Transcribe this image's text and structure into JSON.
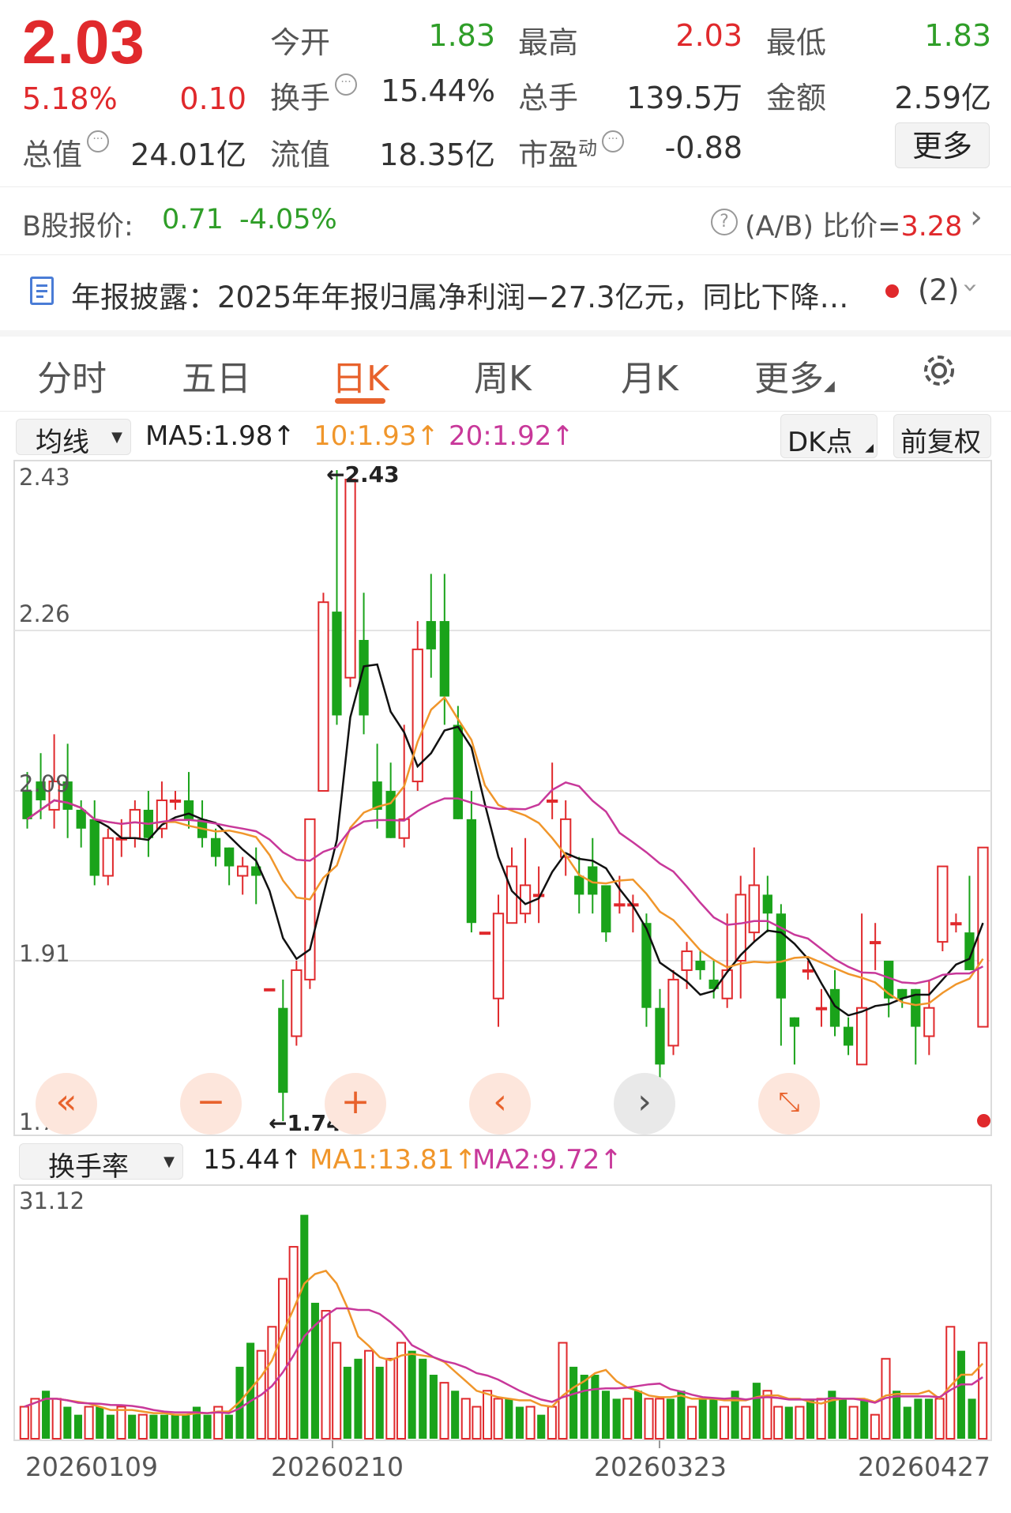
{
  "quote": {
    "price": "2.03",
    "change_pct": "5.18%",
    "change": "0.10",
    "open_label": "今开",
    "open": "1.83",
    "high_label": "最高",
    "high": "2.03",
    "low_label": "最低",
    "low": "1.83",
    "turnover_label": "换手",
    "turnover": "15.44%",
    "volume_label": "总手",
    "volume": "139.5万",
    "amount_label": "金额",
    "amount": "2.59亿",
    "mktcap_label": "总值",
    "mktcap": "24.01亿",
    "float_label": "流值",
    "float_cap": "18.35亿",
    "pe_label": "市盈",
    "pe_sup": "动",
    "pe": "-0.88",
    "more_button": "更多"
  },
  "b_share": {
    "label": "B股报价:",
    "price": "0.71",
    "change": "-4.05%",
    "ratio_label": "(A/B) 比价=",
    "ratio": "3.28"
  },
  "news": {
    "text": "年报披露：2025年年报归属净利润−27.3亿元，同比下降…",
    "count": "(2)"
  },
  "tabs": [
    "分时",
    "五日",
    "日K",
    "周K",
    "月K",
    "更多"
  ],
  "active_tab": "日K",
  "indicator_bar": {
    "select": "均线",
    "ma5": "MA5:1.98",
    "ma10": "10:1.93",
    "ma20": "20:1.92",
    "dk_button": "DK点",
    "adjust_button": "前复权"
  },
  "volume_bar": {
    "select": "换手率",
    "value": "15.44",
    "ma1": "MA1:13.81",
    "ma2": "MA2:9.72"
  },
  "colors": {
    "up": "#e0292c",
    "down": "#1aa31a",
    "ma5": "#111111",
    "ma10": "#f0962b",
    "ma20": "#c8389a",
    "accent": "#e8622c"
  },
  "chart_data": {
    "type": "candlestick",
    "y_ticks": [
      "2.43",
      "2.26",
      "2.09",
      "1.91",
      "1.74"
    ],
    "ylim": [
      1.74,
      2.43
    ],
    "annotations": {
      "max_label": "←2.43",
      "min_label": "←1.74"
    },
    "x_tick_labels": [
      "20260109",
      "20260210",
      "20260323",
      "20260427"
    ],
    "candles": [
      {
        "o": 2.09,
        "c": 2.06,
        "h": 2.11,
        "l": 2.05
      },
      {
        "o": 2.1,
        "c": 2.08,
        "h": 2.13,
        "l": 2.06
      },
      {
        "o": 2.07,
        "c": 2.1,
        "h": 2.15,
        "l": 2.05
      },
      {
        "o": 2.1,
        "c": 2.07,
        "h": 2.14,
        "l": 2.04
      },
      {
        "o": 2.07,
        "c": 2.05,
        "h": 2.08,
        "l": 2.03
      },
      {
        "o": 2.06,
        "c": 2.0,
        "h": 2.08,
        "l": 1.99
      },
      {
        "o": 2.0,
        "c": 2.04,
        "h": 2.05,
        "l": 1.99
      },
      {
        "o": 2.04,
        "c": 2.04,
        "h": 2.06,
        "l": 2.02
      },
      {
        "o": 2.04,
        "c": 2.07,
        "h": 2.08,
        "l": 2.03
      },
      {
        "o": 2.07,
        "c": 2.04,
        "h": 2.09,
        "l": 2.02
      },
      {
        "o": 2.05,
        "c": 2.08,
        "h": 2.1,
        "l": 2.04
      },
      {
        "o": 2.08,
        "c": 2.08,
        "h": 2.09,
        "l": 2.07
      },
      {
        "o": 2.08,
        "c": 2.06,
        "h": 2.11,
        "l": 2.05
      },
      {
        "o": 2.06,
        "c": 2.04,
        "h": 2.08,
        "l": 2.03
      },
      {
        "o": 2.04,
        "c": 2.02,
        "h": 2.05,
        "l": 2.01
      },
      {
        "o": 2.03,
        "c": 2.01,
        "h": 2.03,
        "l": 1.99
      },
      {
        "o": 2.0,
        "c": 2.01,
        "h": 2.02,
        "l": 1.98
      },
      {
        "o": 2.01,
        "c": 2.0,
        "h": 2.03,
        "l": 1.97
      },
      {
        "o": 1.88,
        "c": 1.88,
        "h": 1.88,
        "l": 1.88
      },
      {
        "o": 1.86,
        "c": 1.77,
        "h": 1.89,
        "l": 1.74
      },
      {
        "o": 1.83,
        "c": 1.9,
        "h": 1.91,
        "l": 1.82
      },
      {
        "o": 1.89,
        "c": 2.06,
        "h": 2.06,
        "l": 1.88
      },
      {
        "o": 2.09,
        "c": 2.29,
        "h": 2.3,
        "l": 2.09
      },
      {
        "o": 2.28,
        "c": 2.17,
        "h": 2.43,
        "l": 2.16
      },
      {
        "o": 2.21,
        "c": 2.42,
        "h": 2.42,
        "l": 2.2
      },
      {
        "o": 2.25,
        "c": 2.17,
        "h": 2.3,
        "l": 2.15
      },
      {
        "o": 2.1,
        "c": 2.07,
        "h": 2.14,
        "l": 2.05
      },
      {
        "o": 2.09,
        "c": 2.04,
        "h": 2.12,
        "l": 2.04
      },
      {
        "o": 2.04,
        "c": 2.06,
        "h": 2.16,
        "l": 2.03
      },
      {
        "o": 2.1,
        "c": 2.24,
        "h": 2.27,
        "l": 2.09
      },
      {
        "o": 2.27,
        "c": 2.24,
        "h": 2.32,
        "l": 2.21
      },
      {
        "o": 2.27,
        "c": 2.19,
        "h": 2.32,
        "l": 2.16
      },
      {
        "o": 2.16,
        "c": 2.06,
        "h": 2.18,
        "l": 2.06
      },
      {
        "o": 2.06,
        "c": 1.95,
        "h": 2.09,
        "l": 1.94
      },
      {
        "o": 1.94,
        "c": 1.94,
        "h": 1.94,
        "l": 1.94
      },
      {
        "o": 1.87,
        "c": 1.96,
        "h": 1.98,
        "l": 1.84
      },
      {
        "o": 1.95,
        "c": 2.01,
        "h": 2.03,
        "l": 1.95
      },
      {
        "o": 1.96,
        "c": 1.99,
        "h": 2.04,
        "l": 1.95
      },
      {
        "o": 1.98,
        "c": 1.98,
        "h": 2.01,
        "l": 1.95
      },
      {
        "o": 2.08,
        "c": 2.08,
        "h": 2.12,
        "l": 2.06
      },
      {
        "o": 2.02,
        "c": 2.06,
        "h": 2.08,
        "l": 2.0
      },
      {
        "o": 2.0,
        "c": 1.98,
        "h": 2.02,
        "l": 1.96
      },
      {
        "o": 2.01,
        "c": 1.98,
        "h": 2.04,
        "l": 1.96
      },
      {
        "o": 1.99,
        "c": 1.94,
        "h": 1.99,
        "l": 1.93
      },
      {
        "o": 1.97,
        "c": 1.97,
        "h": 2.0,
        "l": 1.96
      },
      {
        "o": 1.97,
        "c": 1.97,
        "h": 1.98,
        "l": 1.94
      },
      {
        "o": 1.95,
        "c": 1.86,
        "h": 1.96,
        "l": 1.84
      },
      {
        "o": 1.86,
        "c": 1.8,
        "h": 1.88,
        "l": 1.78
      },
      {
        "o": 1.82,
        "c": 1.89,
        "h": 1.9,
        "l": 1.81
      },
      {
        "o": 1.9,
        "c": 1.92,
        "h": 1.93,
        "l": 1.88
      },
      {
        "o": 1.91,
        "c": 1.9,
        "h": 1.92,
        "l": 1.89
      },
      {
        "o": 1.89,
        "c": 1.88,
        "h": 1.91,
        "l": 1.87
      },
      {
        "o": 1.87,
        "c": 1.9,
        "h": 1.96,
        "l": 1.86
      },
      {
        "o": 1.91,
        "c": 1.98,
        "h": 2.0,
        "l": 1.87
      },
      {
        "o": 1.94,
        "c": 1.99,
        "h": 2.03,
        "l": 1.93
      },
      {
        "o": 1.98,
        "c": 1.96,
        "h": 2.0,
        "l": 1.94
      },
      {
        "o": 1.96,
        "c": 1.87,
        "h": 1.97,
        "l": 1.82
      },
      {
        "o": 1.85,
        "c": 1.84,
        "h": 1.85,
        "l": 1.8
      },
      {
        "o": 1.9,
        "c": 1.9,
        "h": 1.91,
        "l": 1.89
      },
      {
        "o": 1.86,
        "c": 1.86,
        "h": 1.88,
        "l": 1.84
      },
      {
        "o": 1.88,
        "c": 1.84,
        "h": 1.9,
        "l": 1.83
      },
      {
        "o": 1.84,
        "c": 1.82,
        "h": 1.85,
        "l": 1.81
      },
      {
        "o": 1.8,
        "c": 1.86,
        "h": 1.96,
        "l": 1.8
      },
      {
        "o": 1.93,
        "c": 1.93,
        "h": 1.95,
        "l": 1.9
      },
      {
        "o": 1.91,
        "c": 1.87,
        "h": 1.91,
        "l": 1.85
      },
      {
        "o": 1.88,
        "c": 1.87,
        "h": 1.88,
        "l": 1.86
      },
      {
        "o": 1.88,
        "c": 1.84,
        "h": 1.88,
        "l": 1.8
      },
      {
        "o": 1.83,
        "c": 1.86,
        "h": 1.89,
        "l": 1.81
      },
      {
        "o": 1.93,
        "c": 2.01,
        "h": 2.01,
        "l": 1.92
      },
      {
        "o": 1.95,
        "c": 1.95,
        "h": 1.96,
        "l": 1.94
      },
      {
        "o": 1.94,
        "c": 1.9,
        "h": 2.0,
        "l": 1.9
      },
      {
        "o": 1.84,
        "c": 2.03,
        "h": 2.03,
        "l": 1.84
      }
    ]
  },
  "volume_data": {
    "y_tick": "31.12",
    "values": [
      4,
      5,
      6,
      5,
      4,
      3,
      4,
      4,
      3,
      4,
      3,
      3,
      3,
      3,
      3,
      3,
      4,
      3,
      4,
      3,
      9,
      12,
      11,
      14,
      20,
      24,
      28,
      17,
      16,
      12,
      9,
      10,
      11,
      9,
      10,
      12,
      11,
      10,
      8,
      7,
      6,
      5,
      4,
      6,
      5,
      5,
      4,
      4,
      3,
      4,
      12,
      9,
      8,
      8,
      6,
      5,
      5,
      6,
      5,
      5,
      5,
      6,
      4,
      5,
      5,
      4,
      6,
      4,
      7,
      6,
      4,
      4,
      4,
      5,
      5,
      6,
      5,
      4,
      5,
      3,
      10,
      6,
      4,
      5,
      5,
      5,
      14,
      11,
      5,
      12
    ],
    "up": [
      1,
      1,
      0,
      1,
      0,
      0,
      1,
      0,
      0,
      1,
      0,
      1,
      0,
      0,
      0,
      0,
      0,
      0,
      1,
      0,
      0,
      0,
      1,
      1,
      1,
      1,
      0,
      0,
      1,
      1,
      0,
      0,
      1,
      0,
      1,
      1,
      0,
      0,
      0,
      1,
      0,
      1,
      1,
      1,
      1,
      0,
      0,
      1,
      0,
      1,
      1,
      0,
      0,
      0,
      0,
      0,
      1,
      0,
      1,
      1,
      0,
      0,
      1,
      0,
      0,
      1,
      0,
      1,
      0,
      1,
      1,
      0,
      1,
      0,
      1,
      0,
      0,
      1,
      0,
      1,
      1,
      0,
      0,
      0,
      0,
      1,
      1,
      0,
      0,
      1
    ]
  }
}
